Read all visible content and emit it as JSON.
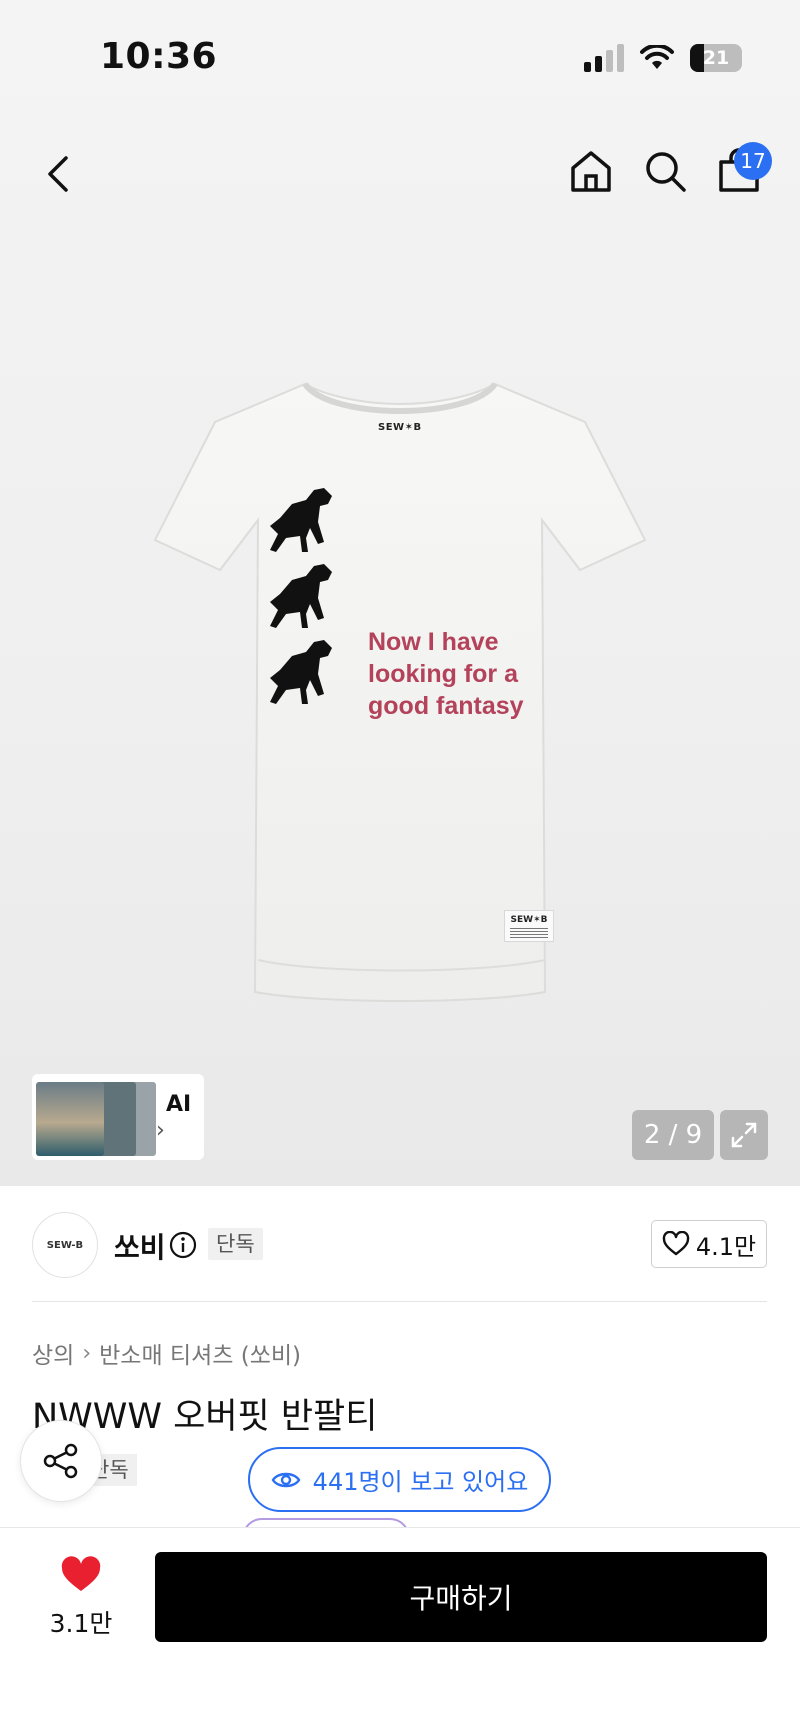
{
  "status_bar": {
    "time": "10:36",
    "battery": "21"
  },
  "nav": {
    "back_icon": "chevron-left-icon",
    "home_icon": "home-icon",
    "search_icon": "search-icon",
    "cart_icon": "shopping-bag-icon",
    "cart_count": "17"
  },
  "product_image": {
    "print_text": [
      "Now I have",
      "looking for a",
      "good fantasy"
    ],
    "collar_label": "SEW✶B",
    "hem_tag": "SEW✶B",
    "print_color": "#b3425a"
  },
  "ai_card": {
    "label": "AI",
    "chevron": "›"
  },
  "gallery": {
    "counter": "2 / 9",
    "expand_icon": "expand-icon"
  },
  "brand": {
    "logo_text": "SEW-B",
    "name": "쏘비",
    "info_icon": "info-icon",
    "exclusive_tag": "단독",
    "like_count": "4.1만"
  },
  "product": {
    "breadcrumb": [
      "상의",
      "반소매 티셔츠 (쏘비)"
    ],
    "title": "NWWW 오버핏 반팔티",
    "tag": "단독"
  },
  "viewers": {
    "text": "441명이 보고 있어요",
    "accent": "#2b6ff2"
  },
  "bottom_bar": {
    "wish_count": "3.1만",
    "buy_label": "구매하기",
    "heart_color": "#e8202f"
  }
}
